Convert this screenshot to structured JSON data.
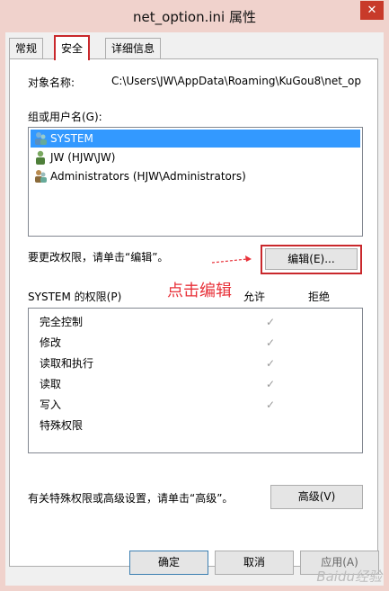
{
  "window": {
    "title": "net_option.ini 属性",
    "close": "✕"
  },
  "tabs": [
    "常规",
    "安全",
    "详细信息"
  ],
  "security": {
    "object_label": "对象名称:",
    "object_value": "C:\\Users\\JW\\AppData\\Roaming\\KuGou8\\net_op",
    "group_label": "组或用户名(G):",
    "users": [
      "SYSTEM",
      "JW (HJW\\JW)",
      "Administrators (HJW\\Administrators)"
    ],
    "change_text": "要更改权限，请单击“编辑”。",
    "edit_button": "编辑(E)...",
    "annotation": "点击编辑",
    "perm_label": "SYSTEM 的权限(P)",
    "allow": "允许",
    "deny": "拒绝",
    "permissions": [
      "完全控制",
      "修改",
      "读取和执行",
      "读取",
      "写入",
      "特殊权限"
    ],
    "allow_checks": [
      true,
      true,
      true,
      true,
      true,
      false
    ],
    "advanced_text": "有关特殊权限或高级设置，请单击“高级”。",
    "advanced_button": "高级(V)"
  },
  "footer": {
    "ok": "确定",
    "cancel": "取消",
    "apply": "应用(A)"
  },
  "watermark": "Baidu经验",
  "colors": {
    "selected": "#3399ff",
    "annotation": "#e8323a",
    "title_frame": "#f0d2cc"
  }
}
